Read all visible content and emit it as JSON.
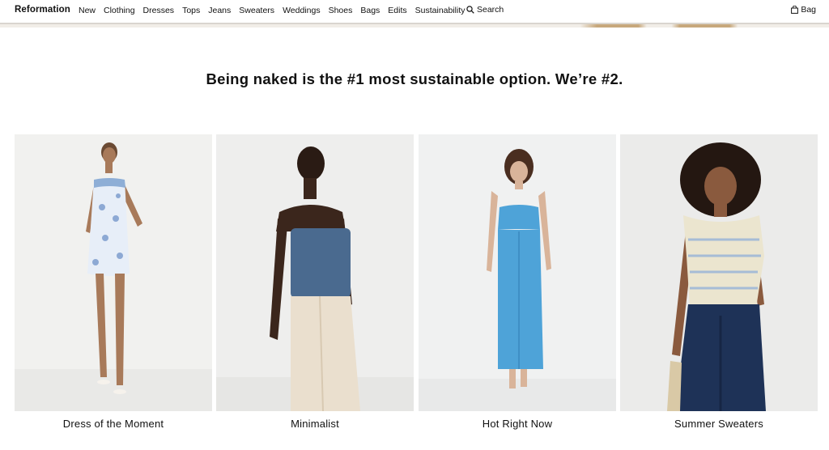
{
  "nav": {
    "logo": "Reformation",
    "links": [
      "New",
      "Clothing",
      "Dresses",
      "Tops",
      "Jeans",
      "Sweaters",
      "Weddings",
      "Shoes",
      "Bags",
      "Edits",
      "Sustainability"
    ],
    "search_label": "Search",
    "bag_label": "Bag"
  },
  "hero": {
    "headline": "Being naked is the #1 most sustainable option. We’re #2."
  },
  "categories": [
    {
      "label": "Dress of the Moment"
    },
    {
      "label": "Minimalist"
    },
    {
      "label": "Hot Right Now"
    },
    {
      "label": "Summer Sweaters"
    }
  ],
  "colors": {
    "text": "#111111",
    "tile_background": "#eeeeec",
    "floral_dress": "#e7eef8",
    "denim_top": "#4a6a8f",
    "blue_dress": "#4ea3d8",
    "sweater": "#ebe5cf",
    "jeans": "#1e3257"
  }
}
